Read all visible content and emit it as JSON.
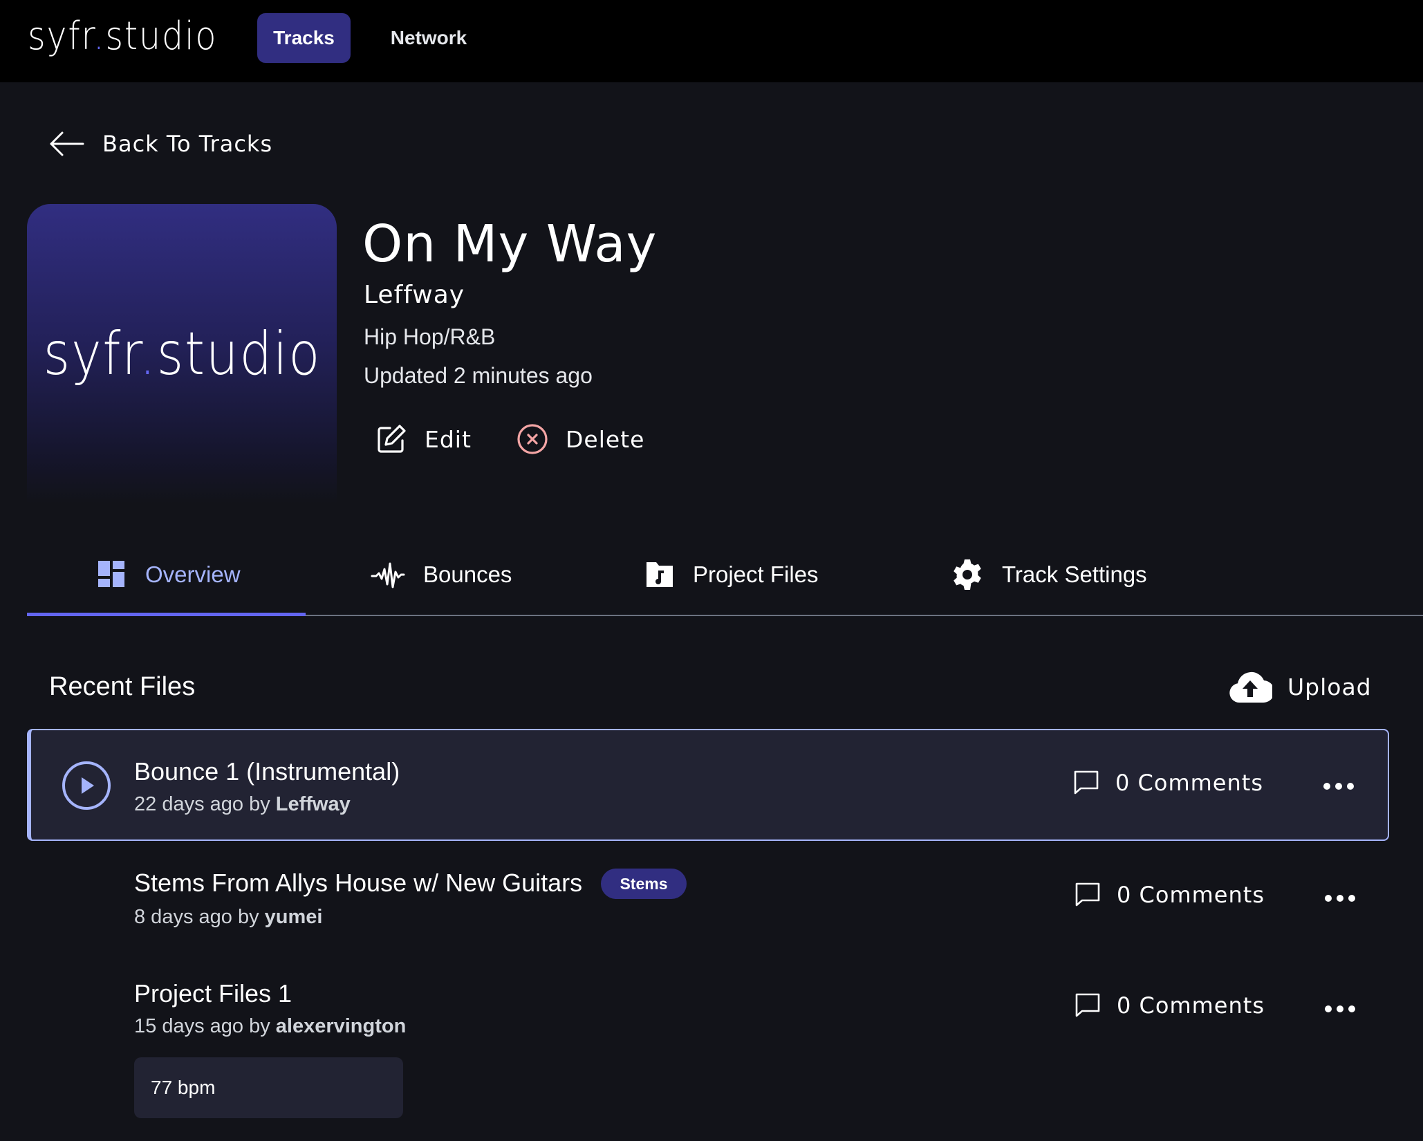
{
  "header": {
    "logo_prefix": "syfr",
    "logo_dot": ".",
    "logo_suffix": "studio",
    "nav": [
      {
        "label": "Tracks",
        "active": true
      },
      {
        "label": "Network",
        "active": false
      }
    ]
  },
  "back_link": {
    "label": "Back To Tracks",
    "icon": "arrow-left-icon"
  },
  "track": {
    "artwork_logo_prefix": "syfr",
    "artwork_logo_dot": ".",
    "artwork_logo_suffix": "studio",
    "title": "On My Way",
    "artist": "Leffway",
    "genre": "Hip Hop/R&B",
    "updated": "Updated 2 minutes ago",
    "actions": [
      {
        "label": "Edit",
        "icon": "edit-icon"
      },
      {
        "label": "Delete",
        "icon": "circle-x-icon"
      }
    ]
  },
  "tabs": [
    {
      "label": "Overview",
      "icon": "dashboard-icon",
      "active": true
    },
    {
      "label": "Bounces",
      "icon": "waveform-icon",
      "active": false
    },
    {
      "label": "Project Files",
      "icon": "music-folder-icon",
      "active": false
    },
    {
      "label": "Track Settings",
      "icon": "gear-icon",
      "active": false
    }
  ],
  "recent_files": {
    "title": "Recent Files",
    "upload_label": "Upload",
    "items": [
      {
        "title": "Bounce 1 (Instrumental)",
        "age": "22 days ago by",
        "author": "Leffway",
        "comments": "0 Comments",
        "selected": true,
        "playable": true
      },
      {
        "title": "Stems From Allys House w/ New Guitars",
        "badge": "Stems",
        "age": "8 days ago by",
        "author": "yumei",
        "comments": "0 Comments"
      },
      {
        "title": "Project Files 1",
        "age": "15 days ago by",
        "author": "alexervington",
        "comments": "0 Comments",
        "bpm": "77 bpm"
      }
    ]
  },
  "colors": {
    "accent": "#6366f1",
    "accent_light": "#a5b4fc",
    "nav_active_bg": "#312e81",
    "page_bg": "#121319",
    "topbar_bg": "#000000",
    "card_bg": "#222333",
    "delete_icon": "#f4a5a5"
  }
}
